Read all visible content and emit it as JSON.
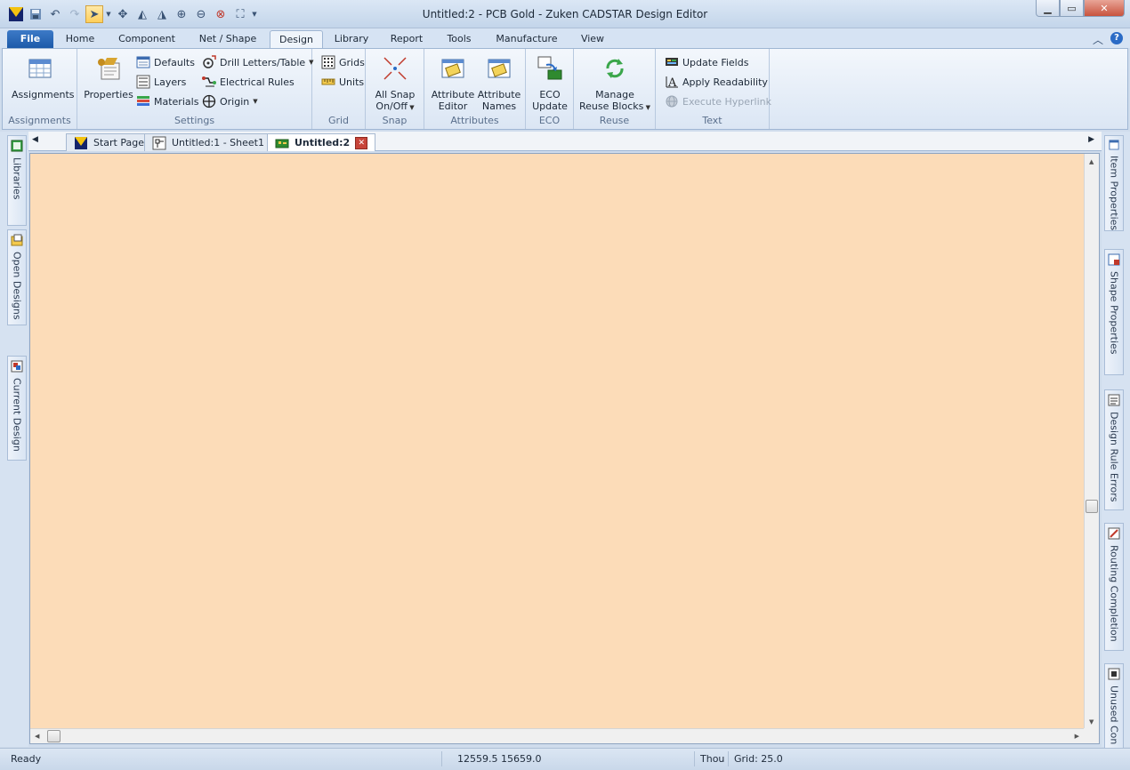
{
  "window": {
    "title": "Untitled:2 - PCB Gold - Zuken CADSTAR Design Editor"
  },
  "ribbon_tabs": [
    "File",
    "Home",
    "Component",
    "Net / Shape",
    "Design",
    "Library",
    "Report",
    "Tools",
    "Manufacture",
    "View"
  ],
  "selected_tab": "Design",
  "groups": {
    "assignments": {
      "name": "Assignments",
      "button": "Assignments"
    },
    "settings": {
      "name": "Settings",
      "properties": "Properties",
      "defaults": "Defaults",
      "layers": "Layers",
      "materials": "Materials",
      "drill": "Drill Letters/Table",
      "electrical": "Electrical Rules",
      "origin": "Origin"
    },
    "grid": {
      "name": "Grid",
      "grids": "Grids",
      "units": "Units"
    },
    "snap": {
      "name": "Snap",
      "line1": "All Snap",
      "line2": "On/Off"
    },
    "attributes": {
      "name": "Attributes",
      "editor1": "Attribute",
      "editor2": "Editor",
      "names1": "Attribute",
      "names2": "Names"
    },
    "eco": {
      "name": "ECO",
      "line1": "ECO",
      "line2": "Update"
    },
    "reuse": {
      "name": "Reuse",
      "line1": "Manage",
      "line2": "Reuse Blocks"
    },
    "text": {
      "name": "Text",
      "update_fields": "Update Fields",
      "apply_readability": "Apply Readability",
      "execute_hyperlink": "Execute Hyperlink"
    }
  },
  "doc_tabs": [
    "Start Page",
    "Untitled:1 - Sheet1",
    "Untitled:2"
  ],
  "left_panels": [
    "Libraries",
    "Open Designs",
    "Current Design"
  ],
  "right_panels": [
    "Item Properties",
    "Shape Properties",
    "Design Rule Errors",
    "Routing Completion",
    "Unused Con"
  ],
  "status": {
    "state": "Ready",
    "coords": "12559.5  15659.0",
    "units": "Thou",
    "grid": "Grid: 25.0"
  },
  "colors": {
    "canvas": "#fcdcb8",
    "accent": "#1d5aa9"
  }
}
